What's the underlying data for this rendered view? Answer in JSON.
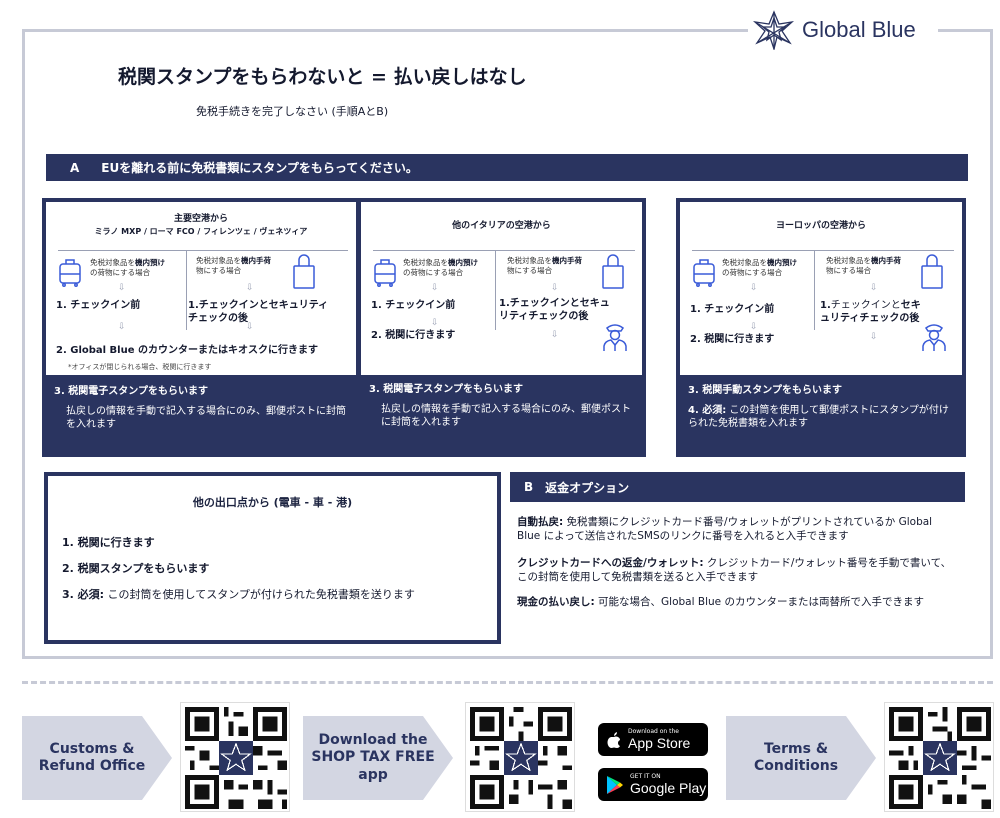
{
  "brand": {
    "name": "Global Blue",
    "color": "#2a3460",
    "frame_color": "#c7cad6"
  },
  "title": "税関スタンプをもらわないと = 払い戻しはなし",
  "subtitle": "免税手続きを完了しなさい (手順AとB)",
  "section_a": {
    "letter": "A",
    "label": "EUを離れる前に免税書類にスタンプをもらってください。"
  },
  "cards": [
    {
      "title_line1": "主要空港から",
      "title_line2": "ミラノ MXP / ローマ FCO / フィレンツェ / ヴェネツィア",
      "left_small_1": "免税対象品を",
      "left_small_bold": "機内預け",
      "left_small_2": "の荷物にする場合",
      "right_small_1": "免税対象品を",
      "right_small_bold": "機内手荷",
      "right_small_2": "物にする場合",
      "left_step": "1. チェックイン前",
      "right_step": "1.チェックインとセキュリティチェックの後",
      "step2": "2. Global Blue のカウンターまたはキオスクに行きます",
      "note": "*オフィスが閉じられる場合、税関に行きます",
      "foot_title": "3. 税関電子スタンプをもらいます",
      "foot_text": "払戻しの情報を手動で記入する場合にのみ、郵便ポストに封筒を入れます"
    },
    {
      "title_line1": "他のイタリアの空港から",
      "left_small_1": "免税対象品を",
      "left_small_bold": "機内預け",
      "left_small_2": "の荷物にする場合",
      "right_small_1": "免税対象品を",
      "right_small_bold": "機内手荷",
      "right_small_2": "物にする場合",
      "left_step": "1. チェックイン前",
      "right_step": "1.チェックインとセキュリティチェックの後",
      "step2": "2. 税関に行きます",
      "foot_title": "3. 税関電子スタンプをもらいます",
      "foot_text": "払戻しの情報を手動で記入する場合にのみ、郵便ポストに封筒を入れます"
    },
    {
      "title_line1": "ヨーロッパの空港から",
      "left_small_1": "免税対象品を",
      "left_small_bold": "機内預け",
      "left_small_2": "の荷物にする場合",
      "right_small_1": "免税対象品を",
      "right_small_bold": "機内手荷",
      "right_small_2": "物にする場合",
      "left_step": "1. チェックイン前",
      "right_step_a": "1.",
      "right_step_b": "チェックインと",
      "right_step_c": "セキュリティチェックの後",
      "step2": "2. 税関に行きます",
      "foot_title": "3. 税関手動スタンプをもらいます",
      "foot_bold": "4. 必須:",
      "foot_text": " この封筒を使用して郵便ポストにスタンプが付けられた免税書類を入れます"
    }
  ],
  "other_exits": {
    "title": "他の出口点から (電車 - 車 - 港)",
    "step1": "1.  税関に行きます",
    "step2": "2.  税関スタンプをもらいます",
    "step3_bold": "3.  必須:",
    "step3_text": " この封筒を使用してスタンプが付けられた免税書類を送ります"
  },
  "section_b": {
    "letter": "B",
    "label": "返金オプション",
    "options": [
      {
        "bold": "自動払戻:",
        "text": " 免税書類にクレジットカード番号/ウォレットがプリントされているか Global Blue によって送信されたSMSのリンクに番号を入れると入手できます"
      },
      {
        "bold": "クレジットカードへの返金/ウォレット:",
        "text": " クレジットカード/ウォレット番号を手動で書いて、この封筒を使用して免税書類を送ると入手できます"
      },
      {
        "bold": "現金の払い戻し:",
        "text": " 可能な場合、Global Blue のカウンターまたは両替所で入手できます"
      }
    ]
  },
  "footer": {
    "customs": "Customs & Refund Office",
    "download": "Download the SHOP TAX FREE app",
    "terms": "Terms & Conditions",
    "app_store_small": "Download on the",
    "app_store_big": "App Store",
    "google_small": "GET IT ON",
    "google_big": "Google Play"
  }
}
